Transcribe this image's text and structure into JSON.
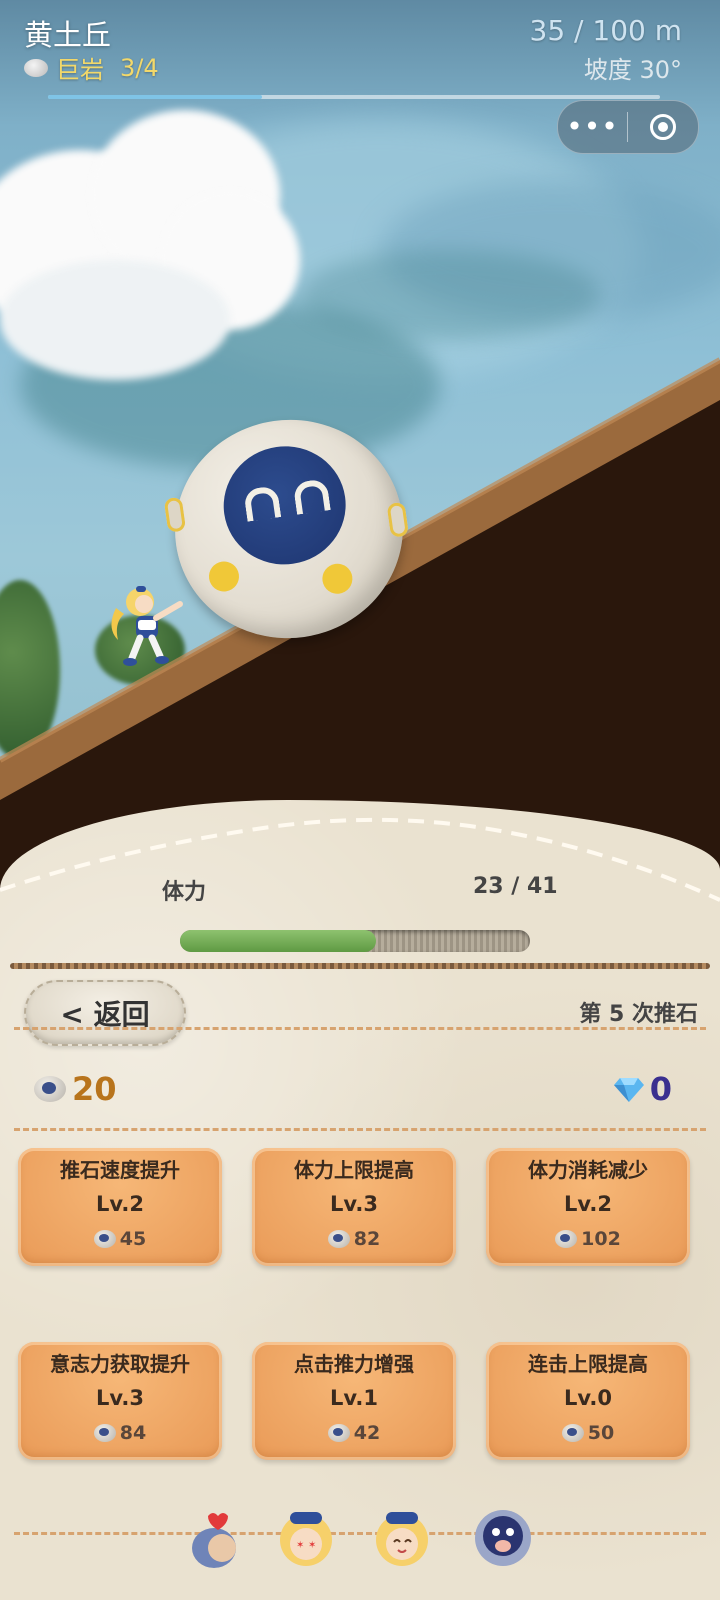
{
  "hud": {
    "title": "黄土丘",
    "rock_label": "巨岩",
    "rock_progress": "3/4",
    "distance": "35 / 100 m",
    "slope": "坡度 30°",
    "distance_fraction": 0.35
  },
  "mini_program_capsule": {
    "more_icon": "more-dots-icon",
    "close_icon": "target-close-icon"
  },
  "stamina": {
    "label": "体力",
    "value": "23 / 41",
    "fraction": 0.561
  },
  "controls": {
    "back_label": "< 返回",
    "push_count": "第 5 次推石"
  },
  "currency": {
    "willpower_amount": "20",
    "gem_amount": "0",
    "willpower_color": "#b8741c",
    "gem_color": "#3a2f8f"
  },
  "upgrades": [
    {
      "name": "推石速度提升",
      "level": "Lv.2",
      "cost": "45"
    },
    {
      "name": "体力上限提高",
      "level": "Lv.3",
      "cost": "82"
    },
    {
      "name": "体力消耗减少",
      "level": "Lv.2",
      "cost": "102"
    },
    {
      "name": "意志力获取提升",
      "level": "Lv.3",
      "cost": "84"
    },
    {
      "name": "点击推力增强",
      "level": "Lv.1",
      "cost": "42"
    },
    {
      "name": "连击上限提高",
      "level": "Lv.0",
      "cost": "50"
    }
  ],
  "bottom_nav": [
    {
      "icon": "heart-character-icon"
    },
    {
      "icon": "dizzy-girl-icon"
    },
    {
      "icon": "happy-girl-icon"
    },
    {
      "icon": "boulder-character-icon"
    }
  ]
}
